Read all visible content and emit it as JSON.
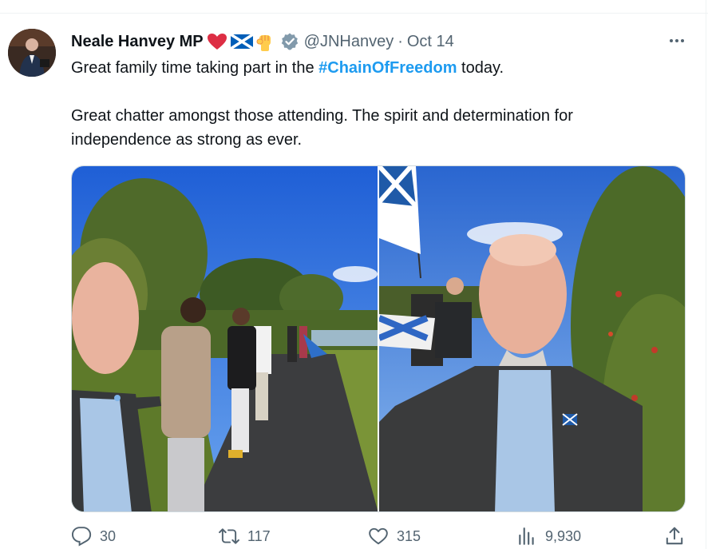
{
  "tweet": {
    "author_name": "Neale Hanvey MP",
    "handle": "@JNHanvey",
    "separator": "·",
    "date": "Oct 14",
    "text_line1_prefix": "Great family time taking part in the ",
    "hashtag": "#ChainOfFreedom",
    "text_line1_suffix": " today.",
    "text_paragraph2": "Great chatter amongst those attending. The spirit and determination for independence as strong as ever.",
    "emojis": [
      "red-heart",
      "scottish-flag",
      "raised-fist"
    ]
  },
  "stats": {
    "replies": "30",
    "retweets": "117",
    "likes": "315",
    "views": "9,930"
  },
  "colors": {
    "accent": "#1d9bf0",
    "secondary_text": "#536471",
    "text": "#0f1419",
    "verified_badge": "#829aab"
  }
}
